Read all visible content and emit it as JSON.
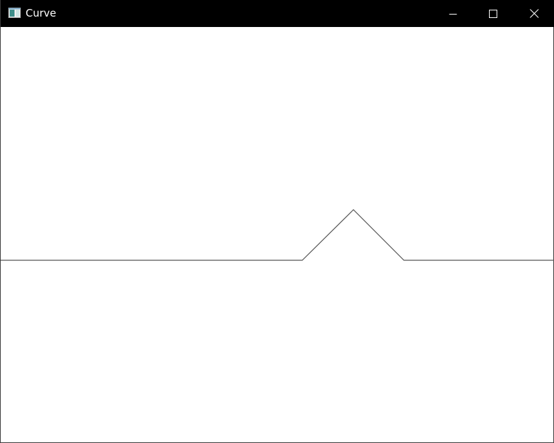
{
  "window": {
    "title": "Curve",
    "icon": "app-window-icon",
    "controls": {
      "minimize_icon": "minimize-icon",
      "maximize_icon": "maximize-icon",
      "close_icon": "close-icon"
    }
  },
  "colors": {
    "titlebar_bg": "#000000",
    "titlebar_text": "#ffffff",
    "canvas_bg": "#ffffff",
    "curve_stroke": "#555555"
  }
}
